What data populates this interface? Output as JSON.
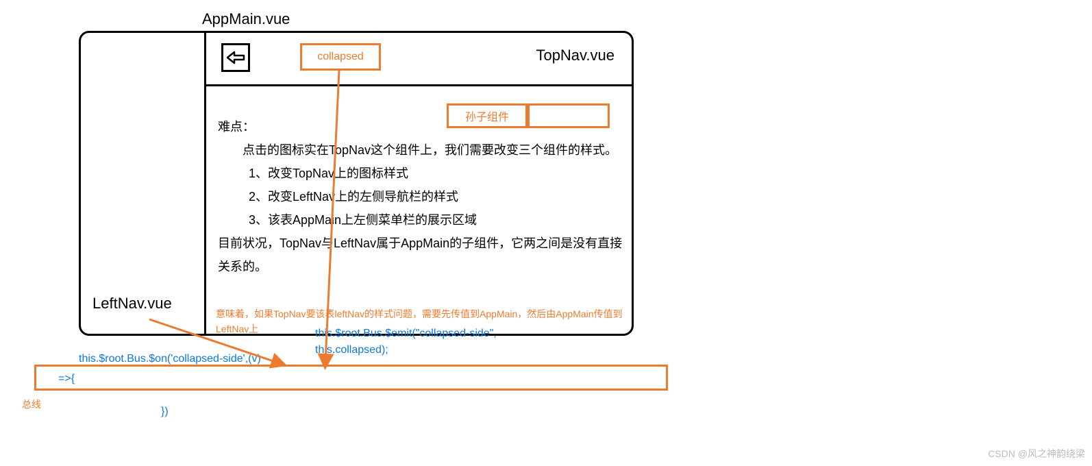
{
  "labels": {
    "appmain": "AppMain.vue",
    "topnav": "TopNav.vue",
    "leftnav": "LeftNav.vue",
    "collapsed": "collapsed",
    "grandson": "孙子组件",
    "bus": "总线",
    "watermark": "CSDN @风之神韵绕梁"
  },
  "content": {
    "title": "难点：",
    "p1": "点击的图标实在TopNav这个组件上，我们需要改变三个组件的样式。",
    "li1": "1、改变TopNav上的图标样式",
    "li2": "2、改变LeftNav上的左侧导航栏的样式",
    "li3": "3、该表AppMain上左侧菜单栏的展示区域",
    "p2": "目前状况，TopNav与LeftNav属于AppMain的子组件，它两之间是没有直接关系的。"
  },
  "note": {
    "orange": "意味着，如果TopNav要该表leftNav的样式问题，需要先传值到AppMain，然后由AppMain传值到LeftNav上",
    "emit_l1": "this.$root.Bus.$emit(\"collapsed-side\",",
    "emit_l2": "this.collapsed);",
    "on": "this.$root.Bus.$on('collapsed-side',(v)",
    "arrow": "=>{",
    "close": "})"
  }
}
